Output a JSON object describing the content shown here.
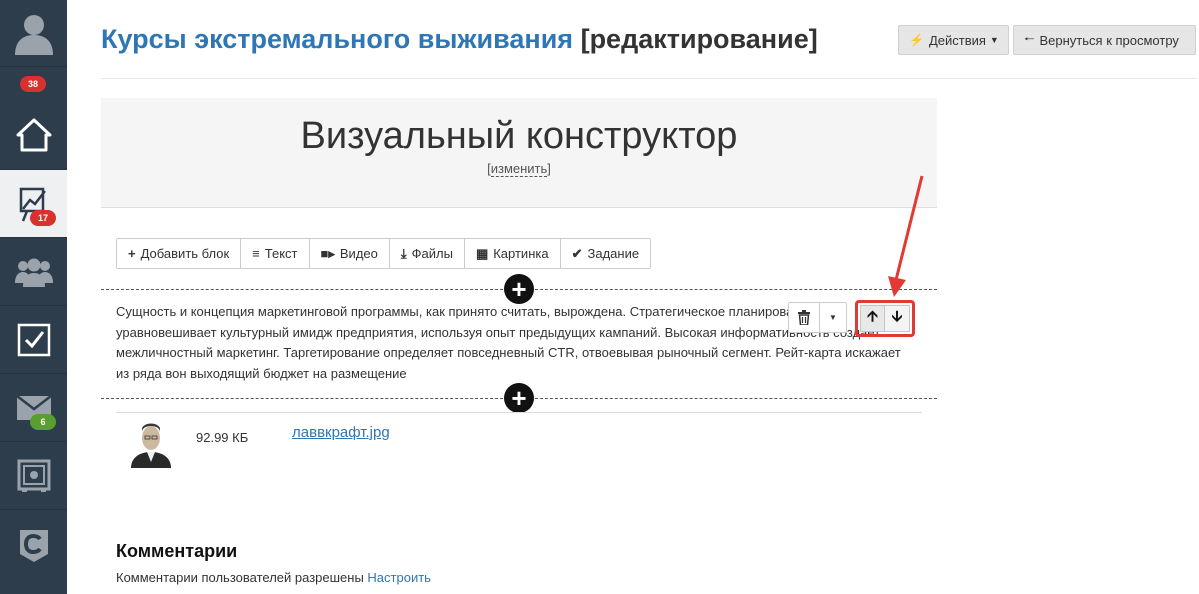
{
  "sidebar": {
    "items": [
      {
        "name": "profile",
        "icon": "user-icon",
        "badge": "38",
        "badge_color": "#d9312e"
      },
      {
        "name": "home",
        "icon": "home-icon",
        "badge": null
      },
      {
        "name": "analytics",
        "icon": "chart-icon",
        "badge": "17",
        "badge_color": "#d9312e",
        "active": true
      },
      {
        "name": "users",
        "icon": "users-icon",
        "badge": null
      },
      {
        "name": "tasks",
        "icon": "checkbox-icon",
        "badge": null
      },
      {
        "name": "mail",
        "icon": "mail-icon",
        "badge": "6",
        "badge_color": "#5a9e2f"
      },
      {
        "name": "safe",
        "icon": "safe-icon",
        "badge": null
      },
      {
        "name": "brand",
        "icon": "logo-c-icon",
        "badge": null
      }
    ]
  },
  "header": {
    "course_title": "Курсы экстремального выживания",
    "mode": "[редактирование]",
    "actions_label": "Действия",
    "back_label": "Вернуться к просмотру"
  },
  "panel": {
    "title": "Визуальный конструктор",
    "change_label": "изменить",
    "bracket_open": "[",
    "bracket_close": "]"
  },
  "toolbar": {
    "add_block": "Добавить блок",
    "text": "Текст",
    "video": "Видео",
    "files": "Файлы",
    "image": "Картинка",
    "task": "Задание"
  },
  "text_block": {
    "content": "Сущность и концепция маркетинговой программы, как принято считать, вырождена. Стратегическое планирование уравновешивает культурный имидж предприятия, используя опыт предыдущих кампаний. Высокая информативность создает межличностный маркетинг. Таргетирование определяет повседневный CTR, отвоевывая рыночный сегмент. Рейт-карта искажает из ряда вон выходящий бюджет на размещение"
  },
  "file_block": {
    "size": "92.99 КБ",
    "name": "лаввкрафт.jpg"
  },
  "comments": {
    "title": "Комментарии",
    "status": "Комментарии пользователей разрешены",
    "configure_label": "Настроить"
  },
  "colors": {
    "sidebar_bg": "#2e3d4c",
    "link": "#2f76b5",
    "highlight": "#e03a33"
  }
}
